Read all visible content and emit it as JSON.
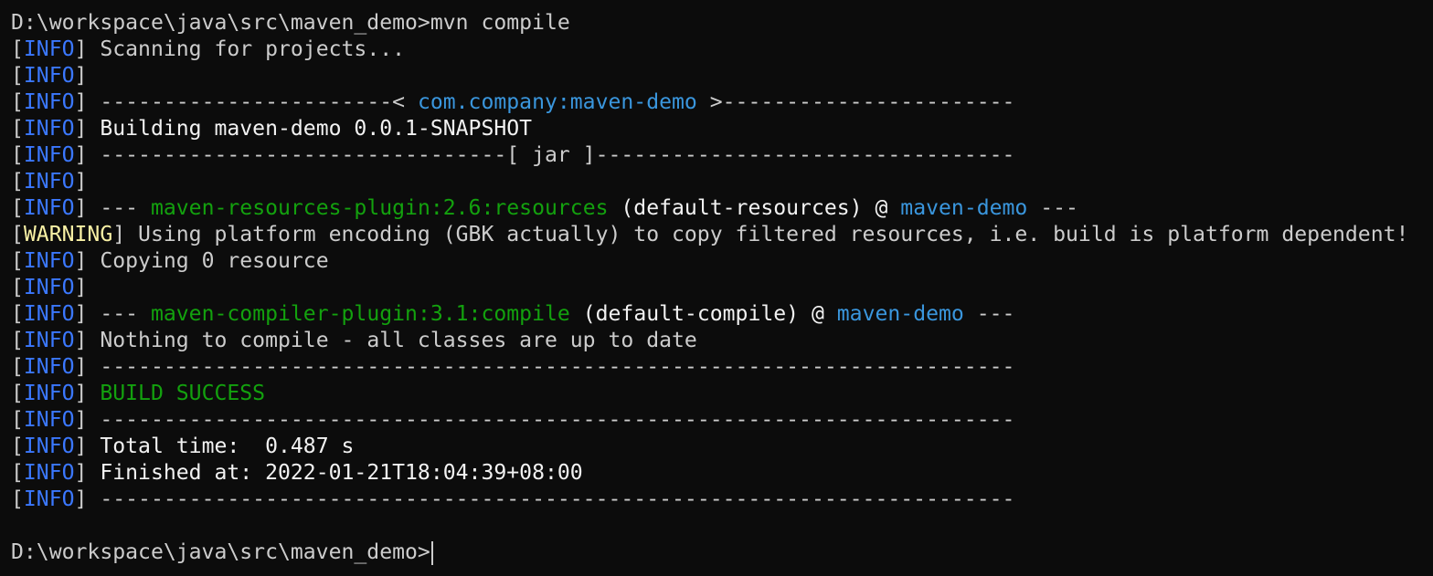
{
  "terminal": {
    "prompt": "D:\\workspace\\java\\src\\maven_demo>",
    "command": "mvn compile",
    "info_tag": "INFO",
    "warning_tag": "WARNING",
    "lines": {
      "scanning": "Scanning for projects...",
      "sep1_left": "-----------------------< ",
      "artifact": "com.company:maven-demo",
      "sep1_right": " >-----------------------",
      "building": "Building maven-demo 0.0.1-SNAPSHOT",
      "sep2": "--------------------------------[ jar ]---------------------------------",
      "dashes3": "--- ",
      "resources_plugin": "maven-resources-plugin:2.6:resources",
      "resources_exec": " (default-resources) @ ",
      "project_name": "maven-demo",
      "dashes3_end": " ---",
      "warning_text": " Using platform encoding (GBK actually) to copy filtered resources, i.e. build is platform dependent!",
      "copying": "Copying 0 resource",
      "compiler_plugin": "maven-compiler-plugin:3.1:compile",
      "compile_exec": " (default-compile) @ ",
      "nothing": "Nothing to compile - all classes are up to date",
      "rule": "------------------------------------------------------------------------",
      "build_success": "BUILD SUCCESS",
      "total_time": "Total time:  0.487 s",
      "finished_at": "Finished at: 2022-01-21T18:04:39+08:00"
    }
  },
  "colors": {
    "background": "#0c0c0c",
    "info": "#3b78ff",
    "warning": "#f9f1a5",
    "link_blue": "#3a96dd",
    "green": "#13a10e",
    "text": "#cccccc"
  }
}
